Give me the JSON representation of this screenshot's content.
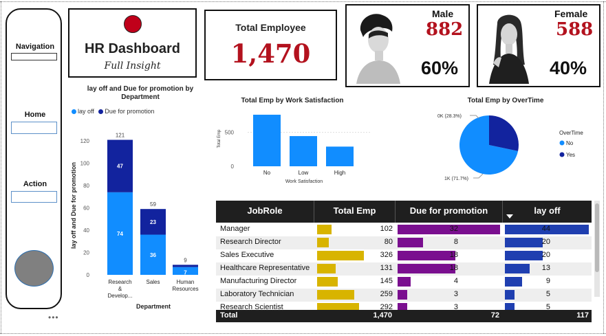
{
  "sidebar": {
    "navigation_label": "Navigation",
    "home_label": "Home",
    "action_label": "Action",
    "more_label": "•••"
  },
  "title_card": {
    "title": "HR Dashboard",
    "subtitle": "Full Insight",
    "dot_color": "#c0001a"
  },
  "total_card": {
    "label": "Total Employee",
    "value": "1,470"
  },
  "male_card": {
    "label": "Male",
    "value": "882",
    "percent": "60%"
  },
  "female_card": {
    "label": "Female",
    "value": "588",
    "percent": "40%"
  },
  "colors": {
    "accent_red": "#b3121e",
    "lay_off": "#118dff",
    "due_promotion": "#12239e",
    "bar_gold": "#d8b400",
    "bar_purple": "#7a0f8f",
    "bar_blue": "#1f3fb0"
  },
  "charts": {
    "dept": {
      "title_line1": "lay off and Due for promotion by",
      "title_line2": "Department",
      "legend": [
        "lay off",
        "Due for promotion"
      ],
      "ylabel": "lay off and Due for promotion",
      "xlabel": "Department",
      "yticks": [
        "0",
        "20",
        "40",
        "60",
        "80",
        "100",
        "120"
      ],
      "cat_labels": [
        [
          "Research",
          "&",
          "Develop..."
        ],
        [
          "Sales"
        ],
        [
          "Human",
          "Resources"
        ]
      ],
      "layoff_labels": [
        "74",
        "36",
        "7"
      ],
      "promo_labels": [
        "47",
        "23",
        ""
      ],
      "total_labels": [
        "121",
        "59",
        "9"
      ]
    },
    "satisfaction": {
      "title": "Total Emp by Work Satisfaction",
      "ylabel": "Total Emp",
      "xlabel": "Work Satisfaction",
      "yticks": [
        "0",
        "500"
      ],
      "categories": [
        "No",
        "Low",
        "High"
      ]
    },
    "overtime": {
      "title": "Total Emp by OverTime",
      "legend_title": "OverTime",
      "legend": [
        "No",
        "Yes"
      ],
      "label_yes": "0K (28.3%)",
      "label_no": "1K (71.7%)"
    }
  },
  "chart_data": [
    {
      "type": "bar",
      "title": "lay off and Due for promotion by Department",
      "categories": [
        "Research & Development",
        "Sales",
        "Human Resources"
      ],
      "series": [
        {
          "name": "lay off",
          "values": [
            74,
            36,
            7
          ]
        },
        {
          "name": "Due for promotion",
          "values": [
            47,
            23,
            2
          ]
        }
      ],
      "totals": [
        121,
        59,
        9
      ],
      "xlabel": "Department",
      "ylabel": "lay off and Due for promotion",
      "ylim": [
        0,
        125
      ],
      "legend_position": "top-left",
      "stacked": true
    },
    {
      "type": "bar",
      "title": "Total Emp by Work Satisfaction",
      "categories": [
        "No",
        "Low",
        "High"
      ],
      "values": [
        760,
        445,
        290
      ],
      "xlabel": "Work Satisfaction",
      "ylabel": "Total Emp",
      "ylim": [
        0,
        800
      ]
    },
    {
      "type": "pie",
      "title": "Total Emp by OverTime",
      "categories": [
        "No",
        "Yes"
      ],
      "values": [
        71.7,
        28.3
      ],
      "legend_position": "right"
    }
  ],
  "table": {
    "headers": [
      "JobRole",
      "Total Emp",
      "Due for promotion",
      "lay off"
    ],
    "rows": [
      {
        "role": "Manager",
        "total": "102",
        "promo": "32",
        "layoff": "44",
        "total_v": 102,
        "promo_v": 32,
        "layoff_v": 44
      },
      {
        "role": "Research Director",
        "total": "80",
        "promo": "8",
        "layoff": "20",
        "total_v": 80,
        "promo_v": 8,
        "layoff_v": 20
      },
      {
        "role": "Sales Executive",
        "total": "326",
        "promo": "18",
        "layoff": "20",
        "total_v": 326,
        "promo_v": 18,
        "layoff_v": 20
      },
      {
        "role": "Healthcare Representative",
        "total": "131",
        "promo": "18",
        "layoff": "13",
        "total_v": 131,
        "promo_v": 18,
        "layoff_v": 13
      },
      {
        "role": "Manufacturing Director",
        "total": "145",
        "promo": "4",
        "layoff": "9",
        "total_v": 145,
        "promo_v": 4,
        "layoff_v": 9
      },
      {
        "role": "Laboratory Technician",
        "total": "259",
        "promo": "3",
        "layoff": "5",
        "total_v": 259,
        "promo_v": 3,
        "layoff_v": 5
      },
      {
        "role": "Research Scientist",
        "total": "292",
        "promo": "3",
        "layoff": "5",
        "total_v": 292,
        "promo_v": 3,
        "layoff_v": 5
      }
    ],
    "total_row": {
      "label": "Total",
      "total": "1,470",
      "promo": "72",
      "layoff": "117"
    }
  }
}
